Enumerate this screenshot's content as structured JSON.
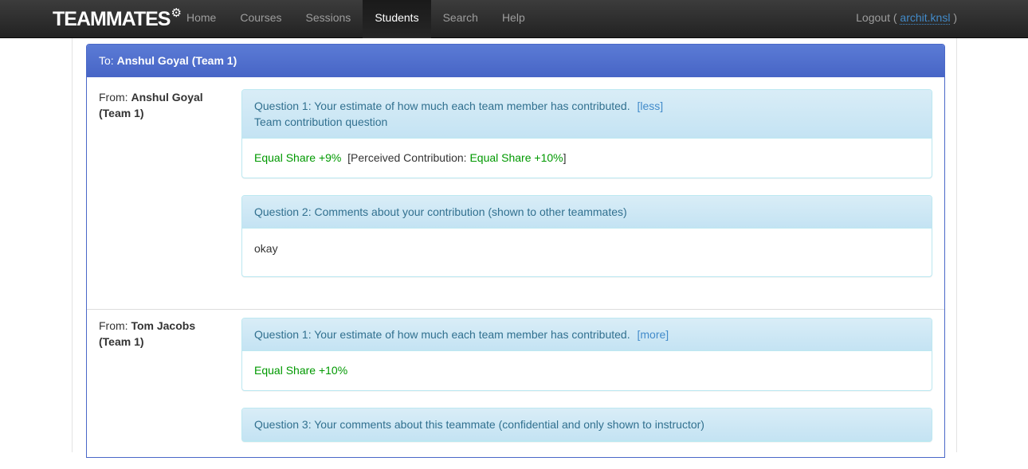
{
  "nav": {
    "brand": "TEAMMATES",
    "brand_icon": "gear-icon",
    "items": [
      {
        "label": "Home"
      },
      {
        "label": "Courses"
      },
      {
        "label": "Sessions"
      },
      {
        "label": "Students"
      },
      {
        "label": "Search"
      },
      {
        "label": "Help"
      }
    ],
    "active": "Students",
    "logout_label": "Logout (",
    "logout_user": "archit.knsl",
    "logout_close": ")"
  },
  "recipient": {
    "prefix": "To:",
    "name": "Anshul Goyal (Team 1)"
  },
  "givers": [
    {
      "from_label": "From:",
      "name": "Anshul Goyal",
      "team": "(Team 1)",
      "questions": [
        {
          "title": "Question 1: Your estimate of how much each team member has contributed.",
          "toggle": "[less]",
          "subtitle": "Team contribution question",
          "answer_main": "Equal Share +9%",
          "perceived_prefix": "[Perceived Contribution:",
          "perceived_value": "Equal Share +10%",
          "perceived_suffix": "]"
        },
        {
          "title": "Question 2: Comments about your contribution (shown to other teammates)",
          "answer": "okay"
        }
      ]
    },
    {
      "from_label": "From:",
      "name": "Tom Jacobs",
      "team": "(Team 1)",
      "questions": [
        {
          "title": "Question 1: Your estimate of how much each team member has contributed.",
          "toggle": "[more]",
          "answer_main": "Equal Share +10%"
        },
        {
          "title": "Question 3: Your comments about this teammate (confidential and only shown to instructor)"
        }
      ]
    }
  ],
  "colors": {
    "navbar": "#222222",
    "panel_primary": "#4765c6",
    "info_heading": "#d9edf7",
    "info_text": "#31708f",
    "link": "#428bca",
    "positive": "#009900"
  }
}
